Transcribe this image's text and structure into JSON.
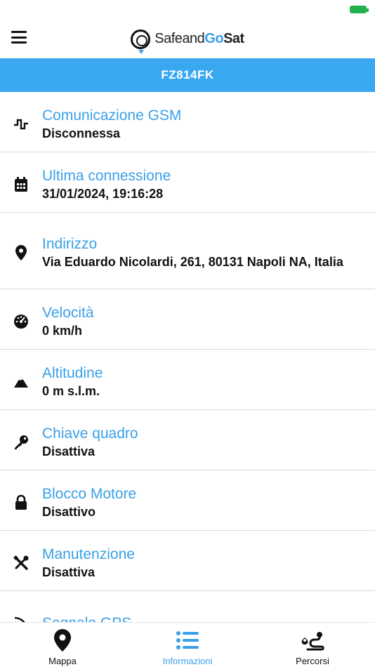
{
  "header": {
    "logo_text_1": "Safe",
    "logo_text_2": "and",
    "logo_text_3": "Go",
    "logo_text_4": "Sat"
  },
  "vehicle": {
    "plate": "FZ814FK"
  },
  "info_rows": [
    {
      "label": "Comunicazione GSM",
      "value": "Disconnessa",
      "icon": "signal-pulse-icon"
    },
    {
      "label": "Ultima connessione",
      "value": "31/01/2024, 19:16:28",
      "icon": "calendar-icon"
    },
    {
      "label": "Indirizzo",
      "value": "Via Eduardo Nicolardi, 261, 80131 Napoli NA, Italia",
      "icon": "map-pin-icon"
    },
    {
      "label": "Velocità",
      "value": "0 km/h",
      "icon": "speedometer-icon"
    },
    {
      "label": "Altitudine",
      "value": "0 m s.l.m.",
      "icon": "mountain-icon"
    },
    {
      "label": "Chiave quadro",
      "value": "Disattiva",
      "icon": "key-icon"
    },
    {
      "label": "Blocco Motore",
      "value": "Disattivo",
      "icon": "lock-icon"
    },
    {
      "label": "Manutenzione",
      "value": "Disattiva",
      "icon": "tools-icon"
    },
    {
      "label": "Segnale GPS",
      "value": "",
      "icon": "gps-signal-icon"
    }
  ],
  "tabs": [
    {
      "label": "Mappa",
      "icon": "map-pin-icon",
      "active": false
    },
    {
      "label": "Informazioni",
      "icon": "list-icon",
      "active": true
    },
    {
      "label": "Percorsi",
      "icon": "route-icon",
      "active": false
    }
  ],
  "colors": {
    "accent": "#3aa0e8",
    "plate_bar": "#3aa8f1",
    "battery": "#22b14c"
  }
}
